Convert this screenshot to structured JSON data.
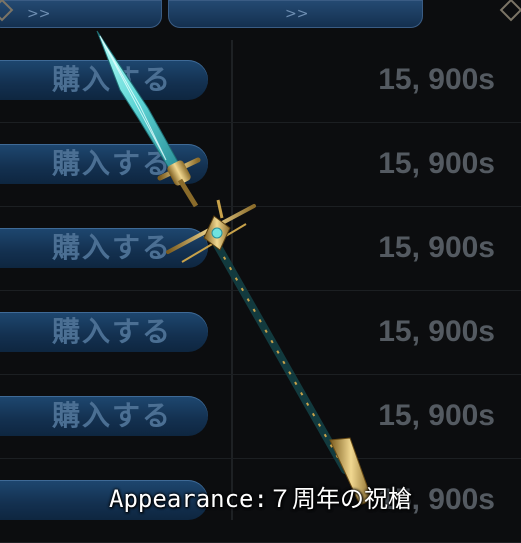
{
  "tabs": [
    {
      "label": ">>"
    },
    {
      "label": ">>"
    }
  ],
  "shop_rows": [
    {
      "buy_label": "購入する",
      "price": "15, 900s"
    },
    {
      "buy_label": "購入する",
      "price": "15, 900s"
    },
    {
      "buy_label": "購入する",
      "price": "15, 900s"
    },
    {
      "buy_label": "購入する",
      "price": "15, 900s"
    },
    {
      "buy_label": "購入する",
      "price": "15, 900s"
    },
    {
      "buy_label": "",
      "price": "15, 900s"
    }
  ],
  "caption": "Appearance:７周年の祝槍",
  "icons": {
    "coin": "coin-icon",
    "weapon": "spear-image"
  },
  "colors": {
    "button": "#1a3d62",
    "price_text": "#545a61",
    "blade": "#6fe3e0",
    "gold": "#c8a24a"
  }
}
